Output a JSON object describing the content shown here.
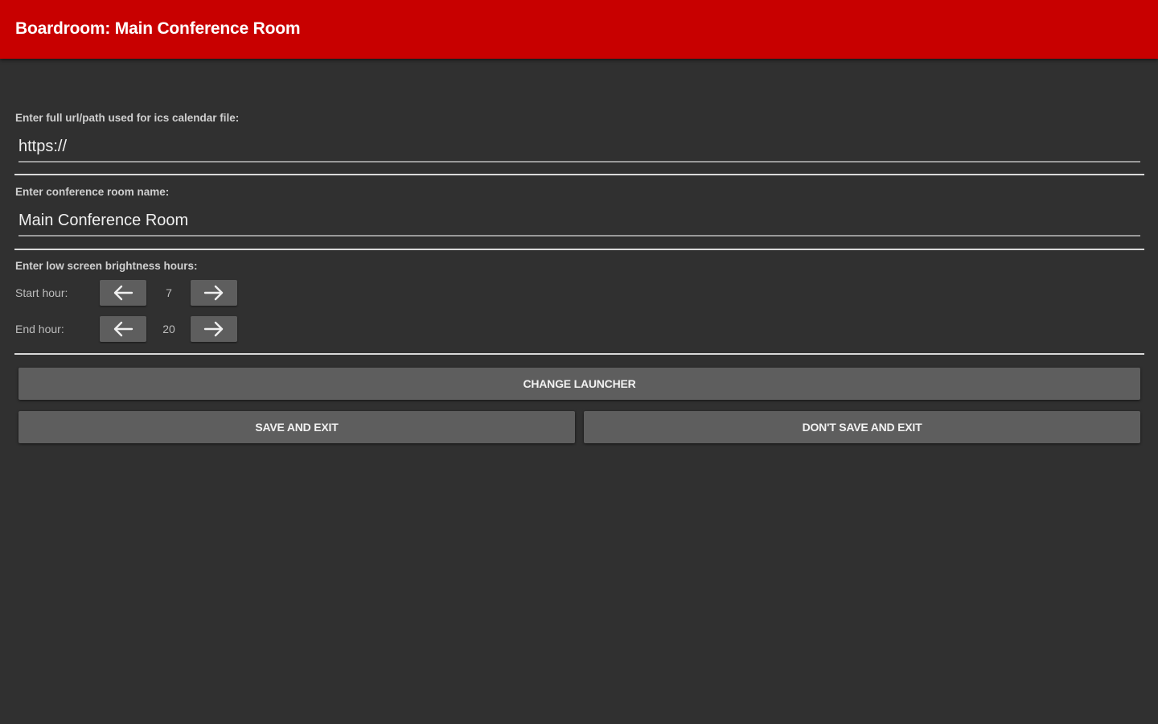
{
  "appbar": {
    "title": "Boardroom: Main Conference Room"
  },
  "calendar": {
    "label": "Enter full url/path used for ics calendar file:",
    "value": "https://"
  },
  "room": {
    "label": "Enter conference room name:",
    "value": "Main Conference Room"
  },
  "brightness": {
    "label": "Enter low screen brightness hours:",
    "start_label": "Start hour:",
    "start_value": "7",
    "end_label": "End hour:",
    "end_value": "20"
  },
  "buttons": {
    "change_launcher": "CHANGE LAUNCHER",
    "save_exit": "SAVE AND EXIT",
    "dont_save_exit": "DON'T SAVE AND EXIT"
  },
  "icons": {
    "decrement": "arrow-left-icon",
    "increment": "arrow-right-icon"
  },
  "colors": {
    "appbar": "#c80000",
    "background": "#303030",
    "button": "#5e5e5e"
  }
}
